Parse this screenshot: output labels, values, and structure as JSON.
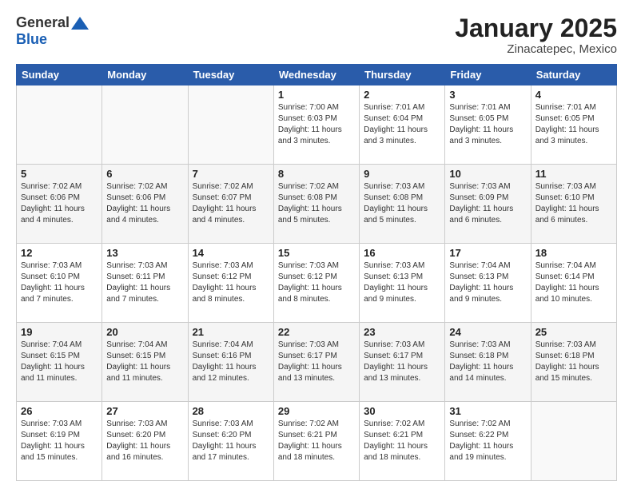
{
  "header": {
    "logo_general": "General",
    "logo_blue": "Blue",
    "month": "January 2025",
    "location": "Zinacatepec, Mexico"
  },
  "weekdays": [
    "Sunday",
    "Monday",
    "Tuesday",
    "Wednesday",
    "Thursday",
    "Friday",
    "Saturday"
  ],
  "weeks": [
    [
      {
        "day": "",
        "info": ""
      },
      {
        "day": "",
        "info": ""
      },
      {
        "day": "",
        "info": ""
      },
      {
        "day": "1",
        "info": "Sunrise: 7:00 AM\nSunset: 6:03 PM\nDaylight: 11 hours\nand 3 minutes."
      },
      {
        "day": "2",
        "info": "Sunrise: 7:01 AM\nSunset: 6:04 PM\nDaylight: 11 hours\nand 3 minutes."
      },
      {
        "day": "3",
        "info": "Sunrise: 7:01 AM\nSunset: 6:05 PM\nDaylight: 11 hours\nand 3 minutes."
      },
      {
        "day": "4",
        "info": "Sunrise: 7:01 AM\nSunset: 6:05 PM\nDaylight: 11 hours\nand 3 minutes."
      }
    ],
    [
      {
        "day": "5",
        "info": "Sunrise: 7:02 AM\nSunset: 6:06 PM\nDaylight: 11 hours\nand 4 minutes."
      },
      {
        "day": "6",
        "info": "Sunrise: 7:02 AM\nSunset: 6:06 PM\nDaylight: 11 hours\nand 4 minutes."
      },
      {
        "day": "7",
        "info": "Sunrise: 7:02 AM\nSunset: 6:07 PM\nDaylight: 11 hours\nand 4 minutes."
      },
      {
        "day": "8",
        "info": "Sunrise: 7:02 AM\nSunset: 6:08 PM\nDaylight: 11 hours\nand 5 minutes."
      },
      {
        "day": "9",
        "info": "Sunrise: 7:03 AM\nSunset: 6:08 PM\nDaylight: 11 hours\nand 5 minutes."
      },
      {
        "day": "10",
        "info": "Sunrise: 7:03 AM\nSunset: 6:09 PM\nDaylight: 11 hours\nand 6 minutes."
      },
      {
        "day": "11",
        "info": "Sunrise: 7:03 AM\nSunset: 6:10 PM\nDaylight: 11 hours\nand 6 minutes."
      }
    ],
    [
      {
        "day": "12",
        "info": "Sunrise: 7:03 AM\nSunset: 6:10 PM\nDaylight: 11 hours\nand 7 minutes."
      },
      {
        "day": "13",
        "info": "Sunrise: 7:03 AM\nSunset: 6:11 PM\nDaylight: 11 hours\nand 7 minutes."
      },
      {
        "day": "14",
        "info": "Sunrise: 7:03 AM\nSunset: 6:12 PM\nDaylight: 11 hours\nand 8 minutes."
      },
      {
        "day": "15",
        "info": "Sunrise: 7:03 AM\nSunset: 6:12 PM\nDaylight: 11 hours\nand 8 minutes."
      },
      {
        "day": "16",
        "info": "Sunrise: 7:03 AM\nSunset: 6:13 PM\nDaylight: 11 hours\nand 9 minutes."
      },
      {
        "day": "17",
        "info": "Sunrise: 7:04 AM\nSunset: 6:13 PM\nDaylight: 11 hours\nand 9 minutes."
      },
      {
        "day": "18",
        "info": "Sunrise: 7:04 AM\nSunset: 6:14 PM\nDaylight: 11 hours\nand 10 minutes."
      }
    ],
    [
      {
        "day": "19",
        "info": "Sunrise: 7:04 AM\nSunset: 6:15 PM\nDaylight: 11 hours\nand 11 minutes."
      },
      {
        "day": "20",
        "info": "Sunrise: 7:04 AM\nSunset: 6:15 PM\nDaylight: 11 hours\nand 11 minutes."
      },
      {
        "day": "21",
        "info": "Sunrise: 7:04 AM\nSunset: 6:16 PM\nDaylight: 11 hours\nand 12 minutes."
      },
      {
        "day": "22",
        "info": "Sunrise: 7:03 AM\nSunset: 6:17 PM\nDaylight: 11 hours\nand 13 minutes."
      },
      {
        "day": "23",
        "info": "Sunrise: 7:03 AM\nSunset: 6:17 PM\nDaylight: 11 hours\nand 13 minutes."
      },
      {
        "day": "24",
        "info": "Sunrise: 7:03 AM\nSunset: 6:18 PM\nDaylight: 11 hours\nand 14 minutes."
      },
      {
        "day": "25",
        "info": "Sunrise: 7:03 AM\nSunset: 6:18 PM\nDaylight: 11 hours\nand 15 minutes."
      }
    ],
    [
      {
        "day": "26",
        "info": "Sunrise: 7:03 AM\nSunset: 6:19 PM\nDaylight: 11 hours\nand 15 minutes."
      },
      {
        "day": "27",
        "info": "Sunrise: 7:03 AM\nSunset: 6:20 PM\nDaylight: 11 hours\nand 16 minutes."
      },
      {
        "day": "28",
        "info": "Sunrise: 7:03 AM\nSunset: 6:20 PM\nDaylight: 11 hours\nand 17 minutes."
      },
      {
        "day": "29",
        "info": "Sunrise: 7:02 AM\nSunset: 6:21 PM\nDaylight: 11 hours\nand 18 minutes."
      },
      {
        "day": "30",
        "info": "Sunrise: 7:02 AM\nSunset: 6:21 PM\nDaylight: 11 hours\nand 18 minutes."
      },
      {
        "day": "31",
        "info": "Sunrise: 7:02 AM\nSunset: 6:22 PM\nDaylight: 11 hours\nand 19 minutes."
      },
      {
        "day": "",
        "info": ""
      }
    ]
  ]
}
